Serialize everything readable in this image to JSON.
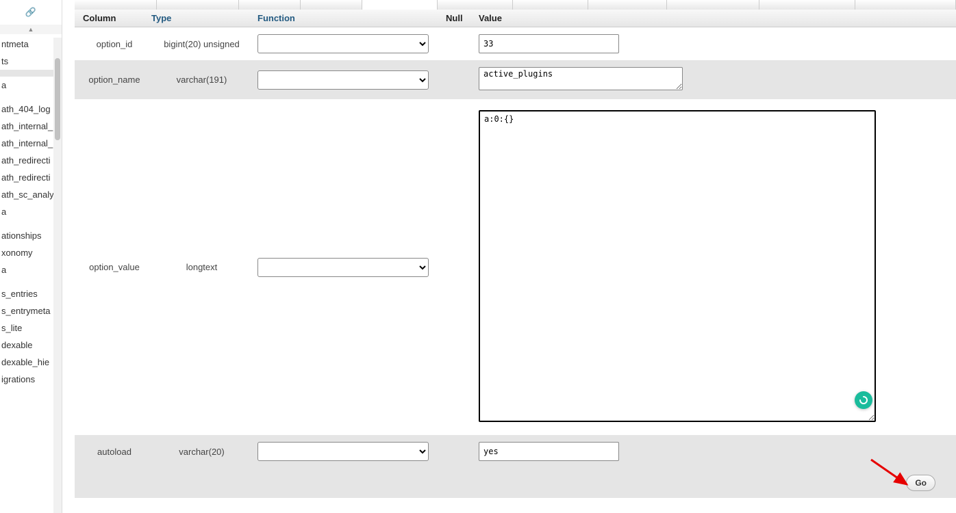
{
  "sidebar": {
    "items": [
      {
        "label": "ntmeta"
      },
      {
        "label": "ts"
      },
      {
        "label": ""
      },
      {
        "label": "a"
      },
      {
        "label": ""
      },
      {
        "label": "ath_404_log"
      },
      {
        "label": "ath_internal_"
      },
      {
        "label": "ath_internal_"
      },
      {
        "label": "ath_redirecti"
      },
      {
        "label": "ath_redirecti"
      },
      {
        "label": "ath_sc_analy"
      },
      {
        "label": "a"
      },
      {
        "label": ""
      },
      {
        "label": "ationships"
      },
      {
        "label": "xonomy"
      },
      {
        "label": "a"
      },
      {
        "label": ""
      },
      {
        "label": "s_entries"
      },
      {
        "label": "s_entrymeta"
      },
      {
        "label": "s_lite"
      },
      {
        "label": "dexable"
      },
      {
        "label": "dexable_hie"
      },
      {
        "label": "igrations"
      }
    ],
    "selected_index": 2
  },
  "headers": {
    "column": "Column",
    "type": "Type",
    "function": "Function",
    "null": "Null",
    "value": "Value"
  },
  "rows": [
    {
      "column": "option_id",
      "type": "bigint(20) unsigned",
      "value": "33",
      "input_kind": "text"
    },
    {
      "column": "option_name",
      "type": "varchar(191)",
      "value": "active_plugins",
      "input_kind": "textarea_sm"
    },
    {
      "column": "option_value",
      "type": "longtext",
      "value": "a:0:{}",
      "input_kind": "textarea_lg"
    },
    {
      "column": "autoload",
      "type": "varchar(20)",
      "value": "yes",
      "input_kind": "text"
    }
  ],
  "go": {
    "label": "Go"
  }
}
